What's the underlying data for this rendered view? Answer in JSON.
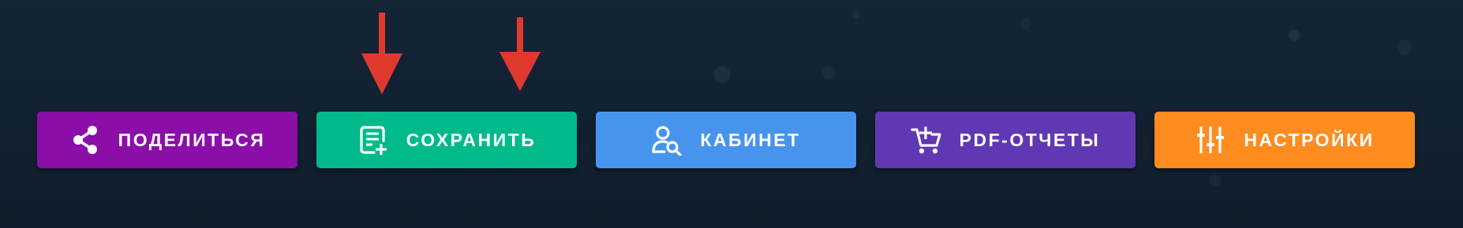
{
  "colors": {
    "background": "#13222f",
    "share": "#8b0ea9",
    "save": "#00ba8b",
    "cabinet": "#4794ee",
    "pdf_reports": "#6038b3",
    "settings": "#ff8c1f",
    "arrow": "#e03a2f"
  },
  "buttons": {
    "share": {
      "label": "ПОДЕЛИТЬСЯ",
      "icon": "share-icon"
    },
    "save": {
      "label": "СОХРАНИТЬ",
      "icon": "note-add-icon"
    },
    "cabinet": {
      "label": "КАБИНЕТ",
      "icon": "user-search-icon"
    },
    "pdf_reports": {
      "label": "PDF-ОТЧЕТЫ",
      "icon": "cart-plus-icon"
    },
    "settings": {
      "label": "НАСТРОЙКИ",
      "icon": "sliders-icon"
    }
  },
  "annotations": {
    "arrows": {
      "count": 2,
      "direction": "down",
      "icon": "arrow-down-icon"
    }
  }
}
